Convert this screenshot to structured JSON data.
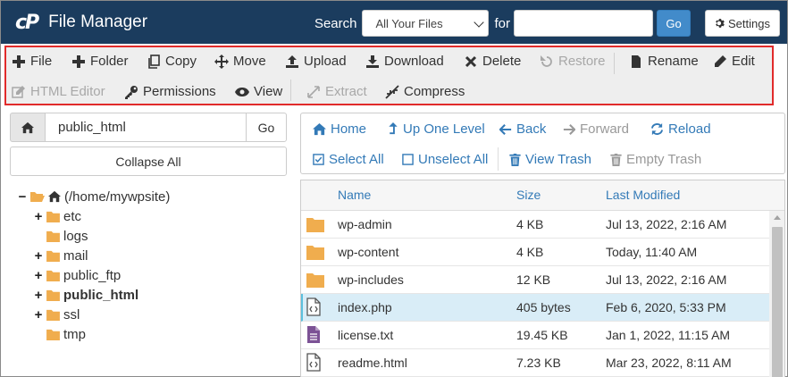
{
  "header": {
    "logo_text": "cP",
    "title": "File Manager",
    "search_label": "Search",
    "search_scope": "All Your Files",
    "for_label": "for",
    "search_value": "",
    "go_label": "Go",
    "settings_label": "Settings"
  },
  "toolbar": {
    "file": "File",
    "folder": "Folder",
    "copy": "Copy",
    "move": "Move",
    "upload": "Upload",
    "download": "Download",
    "delete": "Delete",
    "restore": "Restore",
    "rename": "Rename",
    "edit": "Edit",
    "html_editor": "HTML Editor",
    "permissions": "Permissions",
    "view": "View",
    "extract": "Extract",
    "compress": "Compress"
  },
  "left": {
    "path_value": "public_html",
    "go_label": "Go",
    "collapse_all": "Collapse All",
    "tree": {
      "root": "(/home/mywpsite)",
      "etc": "etc",
      "logs": "logs",
      "mail": "mail",
      "public_ftp": "public_ftp",
      "public_html": "public_html",
      "ssl": "ssl",
      "tmp": "tmp"
    },
    "toggle_expanded": "−",
    "toggle_collapsed": "+"
  },
  "nav": {
    "home": "Home",
    "up_one_level": "Up One Level",
    "back": "Back",
    "forward": "Forward",
    "reload": "Reload",
    "select_all": "Select All",
    "unselect_all": "Unselect All",
    "view_trash": "View Trash",
    "empty_trash": "Empty Trash"
  },
  "table": {
    "columns": {
      "name": "Name",
      "size": "Size",
      "modified": "Last Modified"
    },
    "rows": [
      {
        "name": "wp-admin",
        "size": "4 KB",
        "modified": "Jul 13, 2022, 2:16 AM",
        "icon": "folder-icon"
      },
      {
        "name": "wp-content",
        "size": "4 KB",
        "modified": "Today, 11:40 AM",
        "icon": "folder-icon"
      },
      {
        "name": "wp-includes",
        "size": "12 KB",
        "modified": "Jul 13, 2022, 2:16 AM",
        "icon": "folder-icon"
      },
      {
        "name": "index.php",
        "size": "405 bytes",
        "modified": "Feb 6, 2020, 5:33 PM",
        "icon": "code-file-icon"
      },
      {
        "name": "license.txt",
        "size": "19.45 KB",
        "modified": "Jan 1, 2022, 11:15 AM",
        "icon": "text-file-icon"
      },
      {
        "name": "readme.html",
        "size": "7.23 KB",
        "modified": "Mar 23, 2022, 8:11 AM",
        "icon": "code-file-icon"
      }
    ]
  },
  "colors": {
    "header_bg": "#1b3c5e",
    "highlight_border": "#e12b2b",
    "link": "#337ab7",
    "folder": "#f0ad4e",
    "selected_row": "#d9edf7"
  }
}
